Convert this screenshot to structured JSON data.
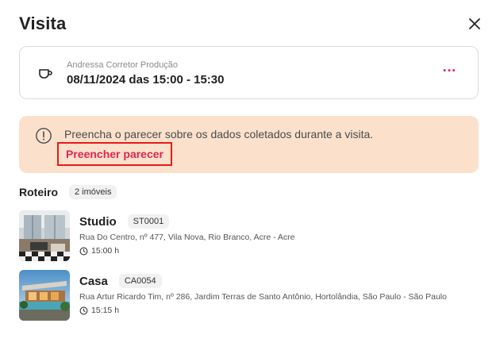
{
  "header": {
    "title": "Visita"
  },
  "visit_card": {
    "agent": "Andressa Corretor Produção",
    "datetime": "08/11/2024 das 15:00 - 15:30",
    "more": "…"
  },
  "notice": {
    "message": "Preencha o parecer sobre os dados coletados durante a visita.",
    "link": "Preencher parecer"
  },
  "roteiro": {
    "label": "Roteiro",
    "count": "2 imóveis",
    "items": [
      {
        "name": "Studio",
        "code": "ST0001",
        "address": "Rua Do Centro, nº 477, Vila Nova, Rio Branco, Acre - Acre",
        "time": "15:00 h"
      },
      {
        "name": "Casa",
        "code": "CA0054",
        "address": "Rua Artur Ricardo Tim, nº 286, Jardim Terras de Santo Antônio, Hortolândia, São Paulo - São Paulo",
        "time": "15:15 h"
      }
    ]
  },
  "colors": {
    "accent": "#e02453",
    "notice_bg": "#fbe1cc",
    "highlight": "#e81a1a"
  },
  "icons": [
    "close-icon",
    "coffee-cup-icon",
    "more-dots-icon",
    "alert-circle-icon",
    "clock-icon"
  ]
}
